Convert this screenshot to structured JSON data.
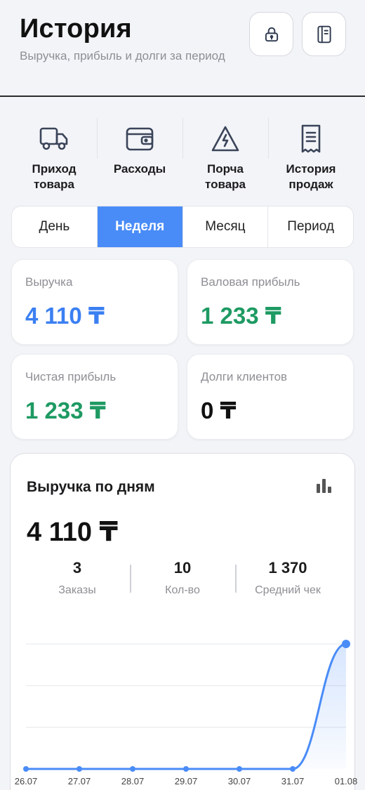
{
  "header": {
    "title": "История",
    "subtitle": "Выручка, прибыль и долги за период",
    "buttons": [
      {
        "icon": "lock-icon"
      },
      {
        "icon": "notebook-icon"
      }
    ]
  },
  "actions": [
    {
      "label": "Приход\nтовара",
      "icon": "truck-icon"
    },
    {
      "label": "Расходы",
      "icon": "wallet-icon"
    },
    {
      "label": "Порча\nтовара",
      "icon": "warning-icon"
    },
    {
      "label": "История\nпродаж",
      "icon": "receipt-icon"
    }
  ],
  "tabs": [
    {
      "label": "День",
      "active": false
    },
    {
      "label": "Неделя",
      "active": true
    },
    {
      "label": "Месяц",
      "active": false
    },
    {
      "label": "Период",
      "active": false
    }
  ],
  "stats": {
    "revenue": {
      "label": "Выручка",
      "value": "4 110 ₸"
    },
    "gross_profit": {
      "label": "Валовая прибыль",
      "value": "1 233 ₸"
    },
    "net_profit": {
      "label": "Чистая прибыль",
      "value": "1 233 ₸"
    },
    "client_debts": {
      "label": "Долги клиентов",
      "value": "0 ₸"
    }
  },
  "revenue_card": {
    "title": "Выручка по дням",
    "total": "4 110 ₸",
    "icon": "bar-chart-icon",
    "kpis": [
      {
        "value": "3",
        "label": "Заказы"
      },
      {
        "value": "10",
        "label": "Кол-во"
      },
      {
        "value": "1 370",
        "label": "Средний чек"
      }
    ]
  },
  "colors": {
    "accent": "#4a8cf7",
    "revenue_blue": "#3b7ff2",
    "profit_green": "#1e9a63"
  },
  "chart_data": {
    "type": "area",
    "categories": [
      "26.07",
      "27.07",
      "28.07",
      "29.07",
      "30.07",
      "31.07",
      "01.08"
    ],
    "values": [
      0,
      0,
      0,
      0,
      0,
      0,
      4110
    ],
    "ylim": [
      0,
      4110
    ],
    "grid": true,
    "legend": "none"
  }
}
